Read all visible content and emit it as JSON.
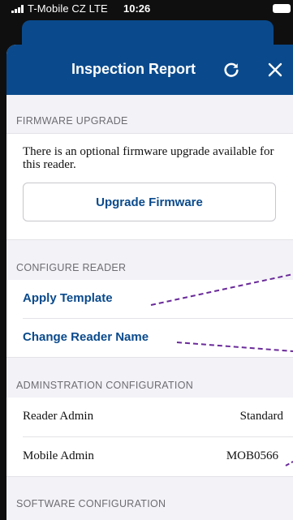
{
  "status_bar": {
    "carrier": "T-Mobile CZ  LTE",
    "time": "10:26"
  },
  "header": {
    "title": "Inspection Report",
    "refresh_icon": "refresh-icon",
    "close_icon": "close-icon"
  },
  "firmware": {
    "section_label": "FIRMWARE UPGRADE",
    "message": "There is an optional firmware upgrade available for this reader.",
    "button_label": "Upgrade Firmware"
  },
  "configure": {
    "section_label": "CONFIGURE READER",
    "items": [
      {
        "label": "Apply Template"
      },
      {
        "label": "Change Reader Name"
      }
    ]
  },
  "admin": {
    "section_label": "ADMINSTRATION CONFIGURATION",
    "rows": [
      {
        "key": "Reader Admin",
        "value": "Standard"
      },
      {
        "key": "Mobile Admin",
        "value": "MOB0566"
      }
    ]
  },
  "software": {
    "section_label": "SOFTWARE CONFIGURATION"
  },
  "colors": {
    "brand": "#0a4a8c",
    "annotation": "#6a2a9a"
  }
}
